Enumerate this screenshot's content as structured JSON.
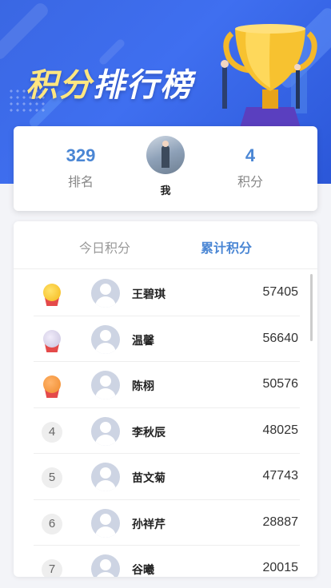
{
  "header": {
    "title_part1": "积分",
    "title_part2": "排行榜"
  },
  "my_stats": {
    "rank_value": "329",
    "rank_label": "排名",
    "name": "我",
    "points_value": "4",
    "points_label": "积分"
  },
  "tabs": [
    {
      "label": "今日积分",
      "active": false
    },
    {
      "label": "累计积分",
      "active": true
    }
  ],
  "leaderboard": [
    {
      "rank": "1",
      "badge": "gold-medal-icon",
      "name": "王碧琪",
      "score": "57405"
    },
    {
      "rank": "2",
      "badge": "silver-medal-icon",
      "name": "温馨",
      "score": "56640"
    },
    {
      "rank": "3",
      "badge": "bronze-medal-icon",
      "name": "陈栩",
      "score": "50576"
    },
    {
      "rank": "4",
      "name": "李秋辰",
      "score": "48025"
    },
    {
      "rank": "5",
      "name": "苗文菊",
      "score": "47743"
    },
    {
      "rank": "6",
      "name": "孙祥芹",
      "score": "28887"
    },
    {
      "rank": "7",
      "name": "谷曦",
      "score": "20015"
    }
  ],
  "colors": {
    "accent": "#4a86d4",
    "banner": "#3f6ff0",
    "title_highlight": "#ffe680"
  }
}
